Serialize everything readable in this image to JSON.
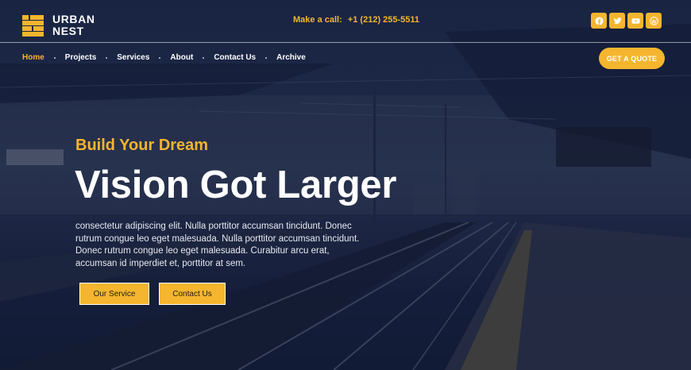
{
  "brand": {
    "line1": "URBAN",
    "line2": "NEST",
    "logo_icon": "brick-logo-icon"
  },
  "header": {
    "call_label": "Make a call:",
    "call_number": "+1 (212) 255-5511",
    "socials": [
      "facebook-icon",
      "twitter-icon",
      "youtube-icon",
      "wordpress-icon"
    ]
  },
  "nav": {
    "items": [
      {
        "label": "Home",
        "active": true
      },
      {
        "label": "Projects"
      },
      {
        "label": "Services"
      },
      {
        "label": "About"
      },
      {
        "label": "Contact Us"
      },
      {
        "label": "Archive"
      }
    ],
    "quote_label": "GET A QUOTE"
  },
  "hero": {
    "subheading": "Build Your Dream",
    "heading": "Vision Got Larger",
    "description": "consectetur adipiscing elit. Nulla porttitor accumsan tincidunt. Donec rutrum congue leo eget malesuada. Nulla porttitor accumsan tincidunt. Donec rutrum congue leo eget malesuada. Curabitur arcu erat, accumsan id imperdiet et, porttitor at sem.",
    "primary_button": "Our Service",
    "secondary_button": "Contact Us"
  },
  "colors": {
    "accent": "#f5b52e",
    "overlay": "#101a38",
    "text": "#ffffff"
  }
}
